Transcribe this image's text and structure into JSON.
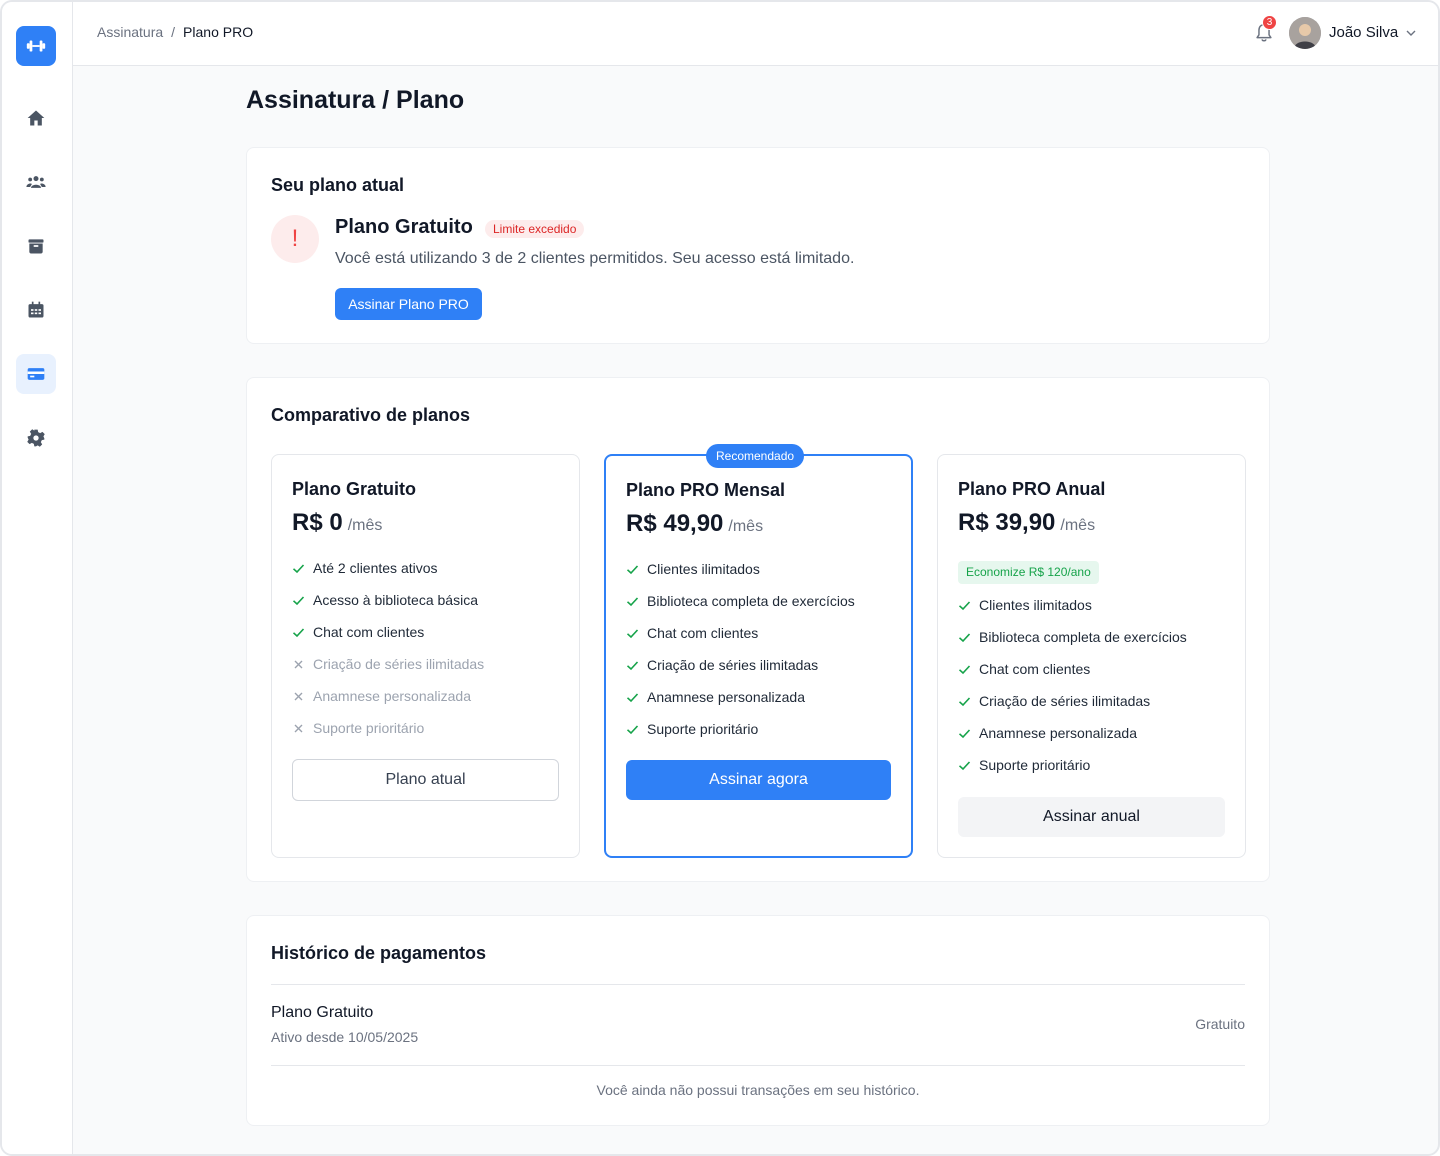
{
  "breadcrumb": {
    "parent": "Assinatura",
    "separator": "/",
    "current": "Plano PRO"
  },
  "header": {
    "notifications_count": "3",
    "user_name": "João Silva"
  },
  "page_title": "Assinatura / Plano",
  "current_plan": {
    "section_title": "Seu plano atual",
    "plan_name": "Plano Gratuito",
    "badge": "Limite excedido",
    "warning_symbol": "!",
    "description": "Você está utilizando 3 de 2 clientes permitidos. Seu acesso está limitado.",
    "cta": "Assinar Plano PRO"
  },
  "comparison": {
    "section_title": "Comparativo de planos",
    "plans": [
      {
        "name": "Plano Gratuito",
        "price": "R$ 0",
        "period": "/mês",
        "features": [
          {
            "text": "Até 2 clientes ativos",
            "included": true
          },
          {
            "text": "Acesso à biblioteca básica",
            "included": true
          },
          {
            "text": "Chat com clientes",
            "included": true
          },
          {
            "text": "Criação de séries ilimitadas",
            "included": false
          },
          {
            "text": "Anamnese personalizada",
            "included": false
          },
          {
            "text": "Suporte prioritário",
            "included": false
          }
        ],
        "button": "Plano atual"
      },
      {
        "name": "Plano PRO Mensal",
        "price": "R$ 49,90",
        "period": "/mês",
        "badge": "Recomendado",
        "features": [
          {
            "text": "Clientes ilimitados",
            "included": true
          },
          {
            "text": "Biblioteca completa de exercícios",
            "included": true
          },
          {
            "text": "Chat com clientes",
            "included": true
          },
          {
            "text": "Criação de séries ilimitadas",
            "included": true
          },
          {
            "text": "Anamnese personalizada",
            "included": true
          },
          {
            "text": "Suporte prioritário",
            "included": true
          }
        ],
        "button": "Assinar agora"
      },
      {
        "name": "Plano PRO Anual",
        "price": "R$ 39,90",
        "period": "/mês",
        "savings": "Economize R$ 120/ano",
        "features": [
          {
            "text": "Clientes ilimitados",
            "included": true
          },
          {
            "text": "Biblioteca completa de exercícios",
            "included": true
          },
          {
            "text": "Chat com clientes",
            "included": true
          },
          {
            "text": "Criação de séries ilimitadas",
            "included": true
          },
          {
            "text": "Anamnese personalizada",
            "included": true
          },
          {
            "text": "Suporte prioritário",
            "included": true
          }
        ],
        "button": "Assinar anual"
      }
    ]
  },
  "history": {
    "section_title": "Histórico de pagamentos",
    "item_name": "Plano Gratuito",
    "item_since": "Ativo desde 10/05/2025",
    "item_status": "Gratuito",
    "empty_message": "Você ainda não possui transações em seu histórico."
  },
  "colors": {
    "primary": "#2f80f6",
    "danger": "#ef4444",
    "success": "#16a34a"
  },
  "icons": [
    "dumbbell-icon",
    "home-icon",
    "users-icon",
    "archive-icon",
    "calendar-icon",
    "credit-card-icon",
    "gear-icon",
    "bell-icon",
    "chevron-down-icon",
    "check-icon",
    "x-icon"
  ]
}
